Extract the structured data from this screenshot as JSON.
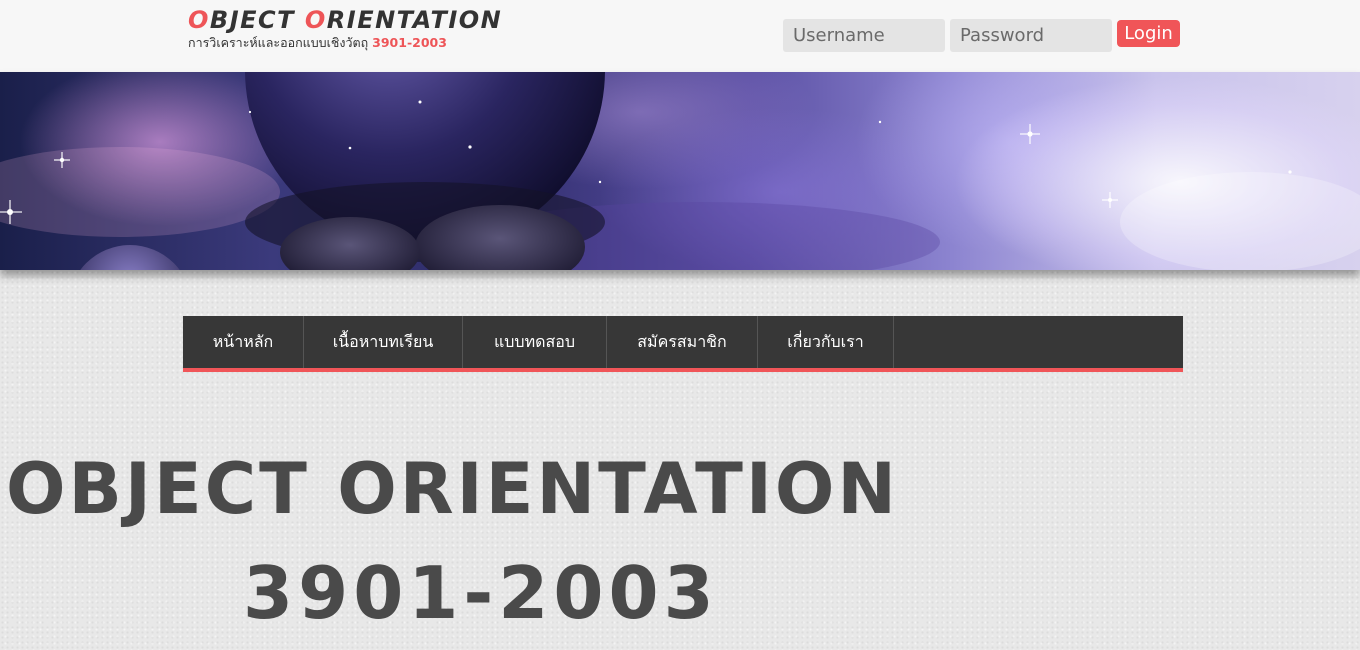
{
  "header": {
    "brand_title_first_initial": "O",
    "brand_title_first_rest": "BJECT ",
    "brand_title_second_initial": "O",
    "brand_title_second_rest": "RIENTATION",
    "brand_subtitle": "การวิเคราะห์และออกแบบเชิงวัตถุ",
    "brand_code": "3901-2003"
  },
  "login": {
    "username_placeholder": "Username",
    "password_placeholder": "Password",
    "login_label": "Login"
  },
  "nav": {
    "items": [
      {
        "label": "หน้าหลัก"
      },
      {
        "label": "เนื้อหาบทเรียน"
      },
      {
        "label": "แบบทดสอบ"
      },
      {
        "label": "สมัครสมาชิก"
      },
      {
        "label": "เกี่ยวกับเรา"
      }
    ]
  },
  "hero": {
    "title": "OBJECT ORIENTATION",
    "code": "3901-2003"
  },
  "colors": {
    "accent": "#f05558",
    "nav_background": "#373737",
    "text_dark": "#4a4a4a"
  }
}
